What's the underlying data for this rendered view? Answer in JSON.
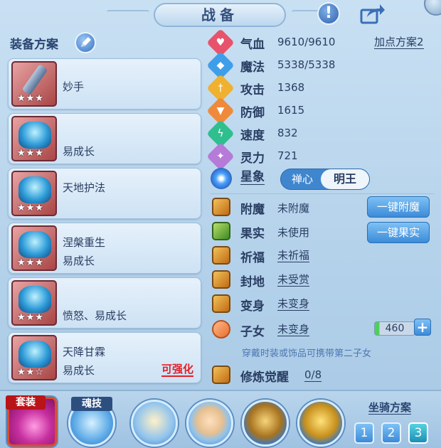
{
  "header": {
    "title": "战备"
  },
  "left": {
    "plan_title": "装备方案",
    "items": [
      {
        "line1": "妙手",
        "line2": "",
        "stars": "★★★",
        "upgrade": ""
      },
      {
        "line1": "",
        "line2": "易成长",
        "stars": "★★★",
        "upgrade": ""
      },
      {
        "line1": "天地护法",
        "line2": "",
        "stars": "★★★",
        "upgrade": ""
      },
      {
        "line1": "涅槃重生",
        "line2": "易成长",
        "stars": "★★★",
        "upgrade": ""
      },
      {
        "line1": "",
        "line2": "愤怒、易成长",
        "stars": "★★★",
        "upgrade": ""
      },
      {
        "line1": "天降甘霖",
        "line2": "易成长",
        "stars": "★★☆",
        "upgrade": "可强化"
      }
    ]
  },
  "stats": {
    "plan_link": "加点方案2",
    "items": [
      {
        "name": "气血",
        "value": "9610/9610",
        "color": "#e8536b",
        "icon": "heart-icon",
        "glyph": "♥"
      },
      {
        "name": "魔法",
        "value": "5338/5338",
        "color": "#3f9ee8",
        "icon": "mana-icon",
        "glyph": "◆"
      },
      {
        "name": "攻击",
        "value": "1368",
        "color": "#f0b030",
        "icon": "attack-icon",
        "glyph": "†"
      },
      {
        "name": "防御",
        "value": "1615",
        "color": "#ef8a3a",
        "icon": "defense-icon",
        "glyph": "▼"
      },
      {
        "name": "速度",
        "value": "832",
        "color": "#2fbf8e",
        "icon": "speed-icon",
        "glyph": "ϟ"
      },
      {
        "name": "灵力",
        "value": "721",
        "color": "#b67ad8",
        "icon": "spirit-icon",
        "glyph": "✦"
      }
    ],
    "xing": {
      "name": "星象",
      "opt_a": "禅心",
      "opt_b": "明王"
    }
  },
  "rows": {
    "fumo": {
      "name": "附魔",
      "value": "未附魔",
      "button": "一键附魔"
    },
    "guoshi": {
      "name": "果实",
      "value": "未使用",
      "button": "一键果实"
    },
    "qifu": {
      "name": "祈福",
      "value": "未祈福"
    },
    "fengdi": {
      "name": "封地",
      "value": "未受赏"
    },
    "bianshen": {
      "name": "变身",
      "value": "未变身"
    },
    "zinv": {
      "name": "子女",
      "value": "未变身",
      "count": "460",
      "plus": "+",
      "progress": 0.12
    },
    "hint": "穿戴时装或饰品可携带第二子女",
    "xiulian": {
      "name": "修炼觉醒",
      "value": "0/8"
    }
  },
  "bottom": {
    "set_label": "套装",
    "soul_label": "魂技",
    "mount_title": "坐骑方案",
    "mount_buttons": [
      "1",
      "2",
      "3"
    ]
  },
  "icons": {
    "help": "!",
    "share": "share-icon"
  }
}
